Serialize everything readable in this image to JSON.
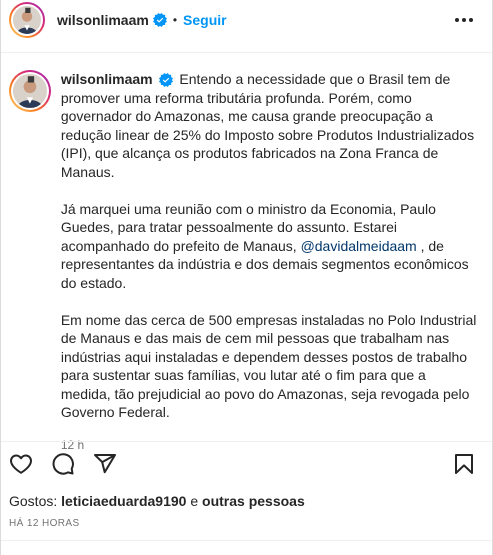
{
  "header": {
    "username": "wilsonlimaam",
    "separator": "•",
    "follow_label": "Seguir",
    "avatar_icon": "profile-avatar",
    "verified_icon": "verified-badge-icon",
    "more_icon": "more-options-icon"
  },
  "caption": {
    "username": "wilsonlimaam",
    "paragraph1": "Entendo a necessidade que o Brasil tem de promover uma reforma tributária profunda. Porém, como governador do Amazonas, me causa grande preocupação a redução linear de 25% do Imposto sobre Produtos Industrializados (IPI), que alcança os produtos fabricados na Zona Franca de Manaus.",
    "paragraph2_before": "Já marquei uma reunião com o ministro da Economia, Paulo Guedes, para tratar pessoalmente do assunto. Estarei acompanhado do prefeito de Manaus, ",
    "paragraph2_mention": "@davidalmeidaam",
    "paragraph2_after": " , de representantes da indústria e dos demais segmentos econômicos do estado.",
    "paragraph3": "Em nome das cerca de 500 empresas instaladas no Polo Industrial de Manaus e das mais de cem mil pessoas que trabalham nas indústrias aqui instaladas e dependem desses postos de trabalho para sustentar suas famílias, vou lutar até o fim para que a medida, tão prejudicial ao povo do Amazonas, seja revogada pelo Governo Federal.",
    "time": "12 h"
  },
  "actions": {
    "like_icon": "heart-icon",
    "comment_icon": "comment-icon",
    "share_icon": "share-icon",
    "save_icon": "bookmark-icon"
  },
  "likes": {
    "prefix": "Gostos: ",
    "user": "leticiaeduarda9190",
    "connector": " e ",
    "others": "outras pessoas"
  },
  "posted_ago": "HÁ 12 HORAS",
  "colors": {
    "accent": "#0095f6",
    "mention": "#00376b",
    "muted": "#737373",
    "text": "#262626"
  }
}
